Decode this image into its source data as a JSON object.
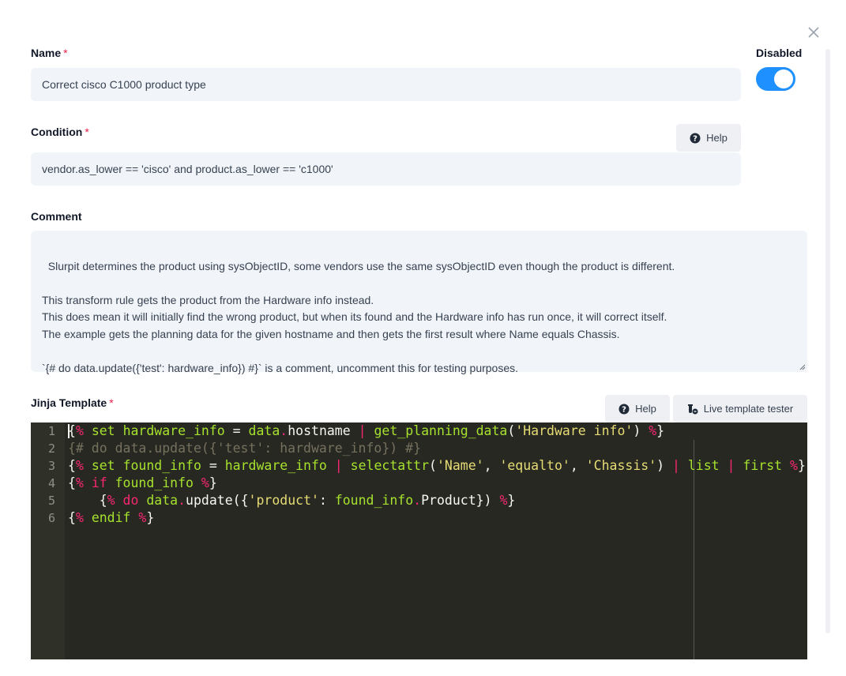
{
  "name": {
    "label": "Name",
    "required_mark": "*",
    "value": "Correct cisco C1000 product type"
  },
  "disabled": {
    "label": "Disabled",
    "on": true,
    "accent": "#1e90ff"
  },
  "condition": {
    "label": "Condition",
    "required_mark": "*",
    "help_label": "Help",
    "value": "vendor.as_lower == 'cisco' and product.as_lower == 'c1000'"
  },
  "comment": {
    "label": "Comment",
    "value": "Slurpit determines the product using sysObjectID, some vendors use the same sysObjectID even though the product is different.\n\nThis transform rule gets the product from the Hardware info instead.\nThis does mean it will initially find the wrong product, but when its found and the Hardware info has run once, it will correct itself.\nThe example gets the planning data for the given hostname and then gets the first result where Name equals Chassis.\n\n`{# do data.update({'test': hardware_info}) #}` is a comment, uncomment this for testing purposes."
  },
  "jinja": {
    "label": "Jinja Template",
    "required_mark": "*",
    "help_label": "Help",
    "tester_label": "Live template tester",
    "line_numbers": [
      "1",
      "2",
      "3",
      "4",
      "5",
      "6"
    ],
    "lines": [
      [
        [
          "{",
          "p"
        ],
        [
          "% ",
          "k"
        ],
        [
          "set ",
          "v"
        ],
        [
          "hardware_info",
          "v"
        ],
        [
          " = ",
          "p"
        ],
        [
          "data",
          "v"
        ],
        [
          ".",
          "k"
        ],
        [
          "hostname ",
          "p"
        ],
        [
          "| ",
          "k"
        ],
        [
          "get_planning_data",
          "v"
        ],
        [
          "(",
          "p"
        ],
        [
          "'Hardware info'",
          "s"
        ],
        [
          ") ",
          "p"
        ],
        [
          "%",
          "k"
        ],
        [
          "}",
          "p"
        ]
      ],
      [
        [
          "{# do data.update({'test': hardware_info}) #}",
          "c"
        ]
      ],
      [
        [
          "{",
          "p"
        ],
        [
          "% ",
          "k"
        ],
        [
          "set ",
          "v"
        ],
        [
          "found_info",
          "v"
        ],
        [
          " = ",
          "p"
        ],
        [
          "hardware_info ",
          "v"
        ],
        [
          "| ",
          "k"
        ],
        [
          "selectattr",
          "v"
        ],
        [
          "(",
          "p"
        ],
        [
          "'Name'",
          "s"
        ],
        [
          ", ",
          "p"
        ],
        [
          "'equalto'",
          "s"
        ],
        [
          ", ",
          "p"
        ],
        [
          "'Chassis'",
          "s"
        ],
        [
          ") ",
          "p"
        ],
        [
          "| ",
          "k"
        ],
        [
          "list ",
          "v"
        ],
        [
          "| ",
          "k"
        ],
        [
          "first ",
          "v"
        ],
        [
          "%",
          "k"
        ],
        [
          "}",
          "p"
        ]
      ],
      [
        [
          "{",
          "p"
        ],
        [
          "% ",
          "k"
        ],
        [
          "if ",
          "k"
        ],
        [
          "found_info ",
          "v"
        ],
        [
          "%",
          "k"
        ],
        [
          "}",
          "p"
        ]
      ],
      [
        [
          "    {",
          "p"
        ],
        [
          "% ",
          "k"
        ],
        [
          "do ",
          "k"
        ],
        [
          "data",
          "v"
        ],
        [
          ".",
          "k"
        ],
        [
          "update({",
          "p"
        ],
        [
          "'product'",
          "s"
        ],
        [
          ": ",
          "p"
        ],
        [
          "found_info",
          "v"
        ],
        [
          ".",
          "k"
        ],
        [
          "Product}) ",
          "p"
        ],
        [
          "%",
          "k"
        ],
        [
          "}",
          "p"
        ]
      ],
      [
        [
          "{",
          "p"
        ],
        [
          "% ",
          "k"
        ],
        [
          "endif ",
          "v"
        ],
        [
          "%",
          "k"
        ],
        [
          "}",
          "p"
        ]
      ]
    ]
  }
}
